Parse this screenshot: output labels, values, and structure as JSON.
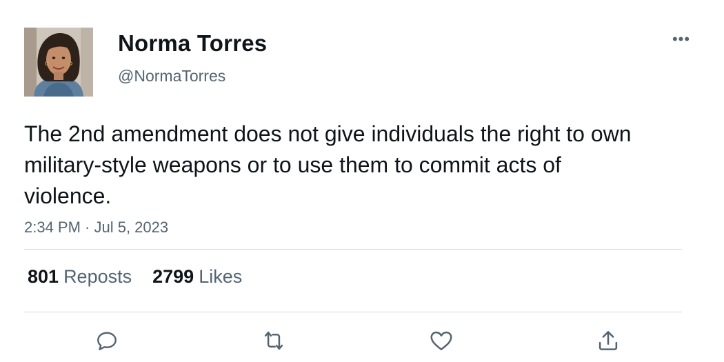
{
  "author": {
    "name": "Norma Torres",
    "handle": "@NormaTorres",
    "avatar_icon": "profile-photo"
  },
  "menu": {
    "more_icon": "more-horizontal-icon",
    "more_glyph": "•••"
  },
  "tweet": {
    "text": "The 2nd amendment does not give individuals the right to own military-style weapons or to use them to commit acts of violence.",
    "timestamp": "2:34 PM · Jul 5, 2023"
  },
  "stats": {
    "reposts": {
      "count": "801",
      "label": "Reposts"
    },
    "likes": {
      "count": "2799",
      "label": "Likes"
    }
  },
  "actions": [
    "reply-icon",
    "repost-icon",
    "like-icon",
    "share-icon"
  ],
  "colors": {
    "text_primary": "#0f1419",
    "text_secondary": "#536471",
    "divider": "#d4d9dd",
    "icon": "#536471"
  }
}
